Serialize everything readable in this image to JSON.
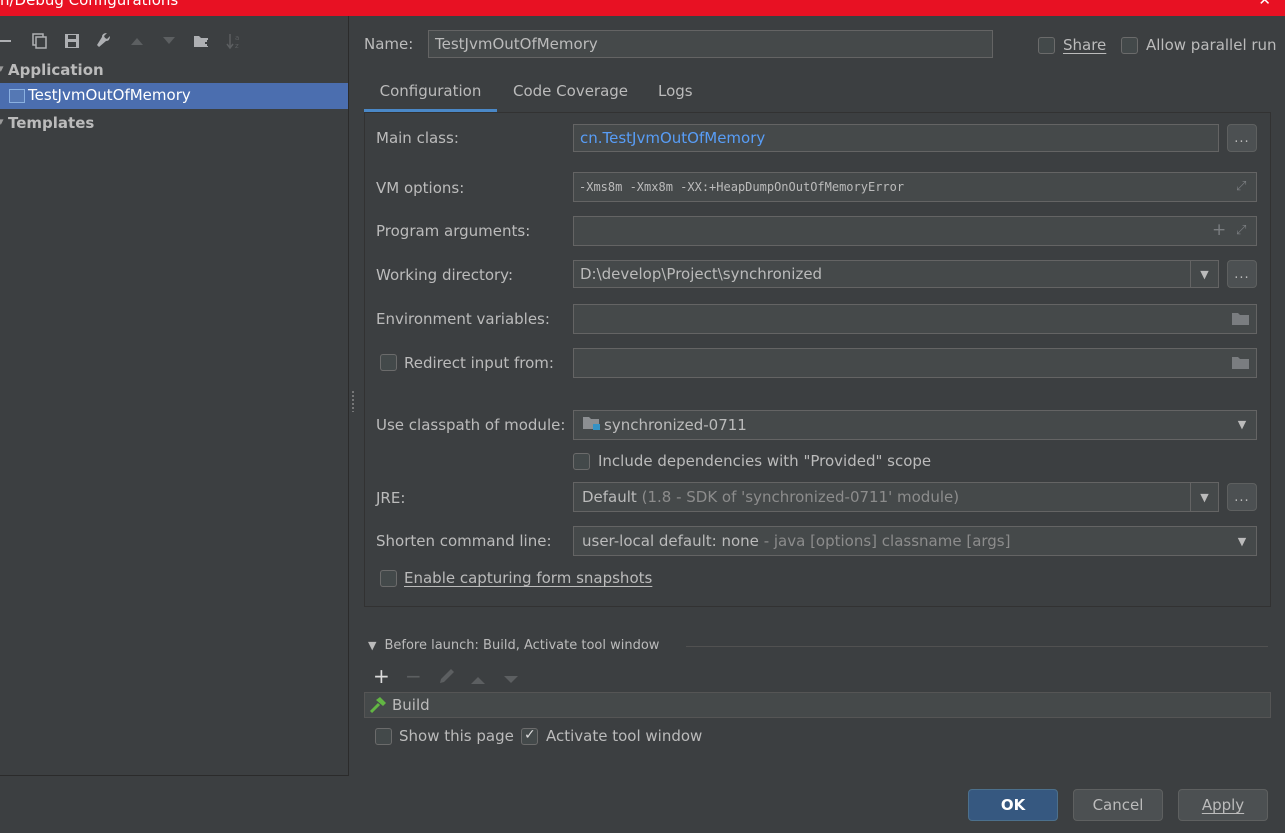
{
  "window": {
    "title": "n/Debug Configurations",
    "close": "✕"
  },
  "tree": {
    "group_application": "Application",
    "selected_item": "TestJvmOutOfMemory",
    "group_templates": "Templates"
  },
  "name": {
    "label": "Name:",
    "value": "TestJvmOutOfMemory"
  },
  "share": {
    "label": "Share"
  },
  "parallel": {
    "label": "Allow parallel run"
  },
  "tabs": [
    "Configuration",
    "Code Coverage",
    "Logs"
  ],
  "config": {
    "main_class_label": "Main class:",
    "main_class_value": "cn.TestJvmOutOfMemory",
    "vm_options_label": "VM options:",
    "vm_options_value": "-Xms8m -Xmx8m -XX:+HeapDumpOnOutOfMemoryError",
    "program_args_label": "Program arguments:",
    "working_dir_label": "Working directory:",
    "working_dir_value": "D:\\develop\\Project\\synchronized",
    "env_vars_label": "Environment variables:",
    "redirect_label": "Redirect input from:",
    "classpath_label": "Use classpath of module:",
    "classpath_value": "synchronized-0711",
    "include_deps_label": "Include dependencies with \"Provided\" scope",
    "jre_label": "JRE:",
    "jre_value_main": "Default",
    "jre_value_detail": "(1.8 - SDK of 'synchronized-0711' module)",
    "shorten_label": "Shorten command line:",
    "shorten_value_main": "user-local default: none",
    "shorten_value_detail": "- java [options] classname [args]",
    "snapshots_label": "Enable capturing form snapshots",
    "dots": "..."
  },
  "before_launch": {
    "title": "Before launch: Build, Activate tool window",
    "task": "Build",
    "show_page_label": "Show this page",
    "activate_label": "Activate tool window",
    "activate_checked": true
  },
  "buttons": {
    "ok": "OK",
    "cancel": "Cancel",
    "apply": "Apply"
  },
  "colors": {
    "accent": "#4a88c7",
    "selection": "#4b6eaf",
    "titlebar": "#e81123",
    "primary_button": "#365880"
  }
}
